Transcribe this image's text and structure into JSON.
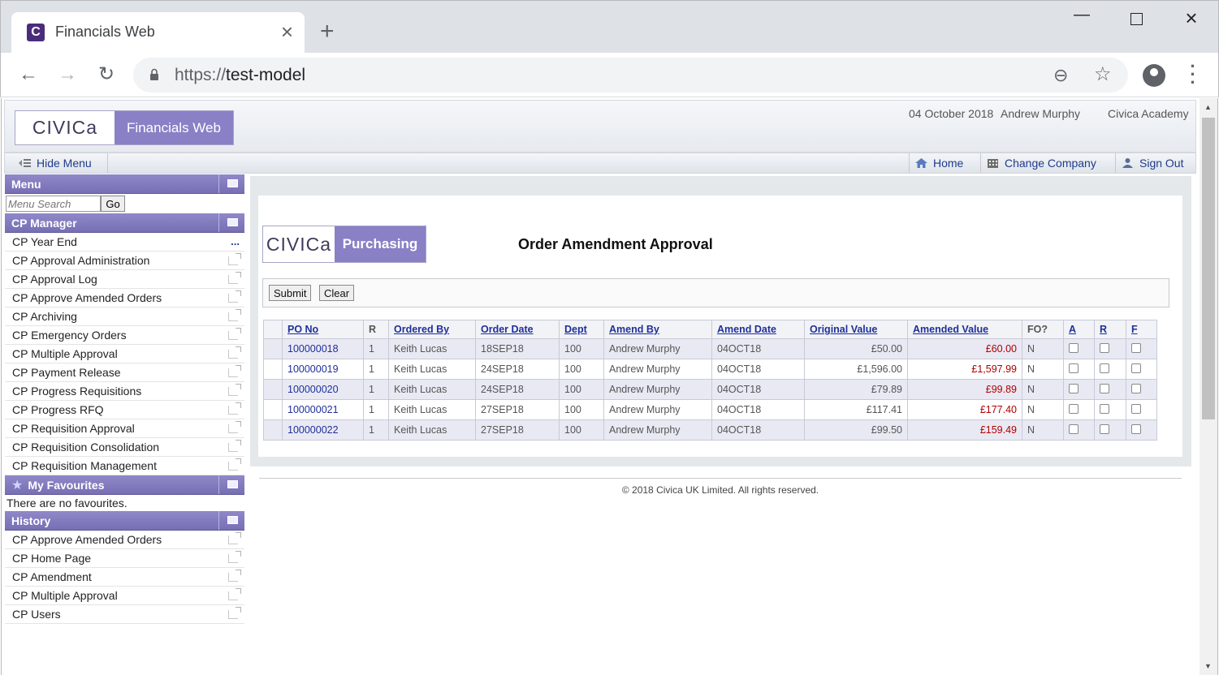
{
  "browser": {
    "tab_title": "Financials Web",
    "favicon_letter": "C",
    "url_scheme": "https://",
    "url_host": "test-model"
  },
  "header": {
    "logo_brand": "CIVICa",
    "logo_product": "Financials Web",
    "date": "04 October 2018",
    "user": "Andrew Murphy",
    "company": "Civica Academy"
  },
  "toolbar": {
    "hide_menu": "Hide Menu",
    "home": "Home",
    "change_company": "Change Company",
    "sign_out": "Sign Out"
  },
  "sidebar": {
    "menu_title": "Menu",
    "search_placeholder": "Menu Search",
    "go_label": "Go",
    "cp_manager_title": "CP Manager",
    "cp_items": [
      "CP Year End",
      "CP Approval Administration",
      "CP Approval Log",
      "CP Approve Amended Orders",
      "CP Archiving",
      "CP Emergency Orders",
      "CP Multiple Approval",
      "CP Payment Release",
      "CP Progress Requisitions",
      "CP Progress RFQ",
      "CP Requisition Approval",
      "CP Requisition Consolidation",
      "CP Requisition Management"
    ],
    "favourites_title": "My Favourites",
    "favourites_empty": "There are no favourites.",
    "history_title": "History",
    "history_items": [
      "CP Approve Amended Orders",
      "CP Home Page",
      "CP Amendment",
      "CP Multiple Approval",
      "CP Users"
    ]
  },
  "main": {
    "logo_brand": "CIVICa",
    "logo_product": "Purchasing",
    "title": "Order Amendment Approval",
    "submit_label": "Submit",
    "clear_label": "Clear",
    "columns": [
      "PO No",
      "R",
      "Ordered By",
      "Order Date",
      "Dept",
      "Amend By",
      "Amend Date",
      "Original Value",
      "Amended Value",
      "FO?",
      "A",
      "R",
      "F"
    ],
    "rows": [
      [
        "100000018",
        "1",
        "Keith Lucas",
        "18SEP18",
        "100",
        "Andrew Murphy",
        "04OCT18",
        "£50.00",
        "£60.00",
        "N"
      ],
      [
        "100000019",
        "1",
        "Keith Lucas",
        "24SEP18",
        "100",
        "Andrew Murphy",
        "04OCT18",
        "£1,596.00",
        "£1,597.99",
        "N"
      ],
      [
        "100000020",
        "1",
        "Keith Lucas",
        "24SEP18",
        "100",
        "Andrew Murphy",
        "04OCT18",
        "£79.89",
        "£99.89",
        "N"
      ],
      [
        "100000021",
        "1",
        "Keith Lucas",
        "27SEP18",
        "100",
        "Andrew Murphy",
        "04OCT18",
        "£117.41",
        "£177.40",
        "N"
      ],
      [
        "100000022",
        "1",
        "Keith Lucas",
        "27SEP18",
        "100",
        "Andrew Murphy",
        "04OCT18",
        "£99.50",
        "£159.49",
        "N"
      ]
    ]
  },
  "footer": {
    "copyright": "© 2018 Civica UK Limited. All rights reserved."
  },
  "colors": {
    "accent": "#8a80c6",
    "link": "#1f2f9a",
    "amended_value": "#b00000"
  }
}
